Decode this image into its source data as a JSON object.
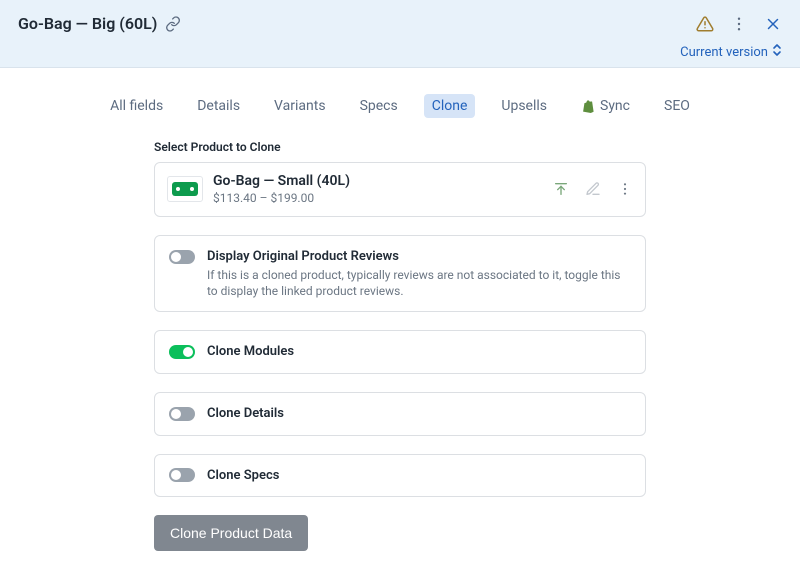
{
  "header": {
    "title": "Go-Bag — Big (60L)",
    "version_label": "Current version"
  },
  "tabs": {
    "all_fields": "All fields",
    "details": "Details",
    "variants": "Variants",
    "specs": "Specs",
    "clone": "Clone",
    "upsells": "Upsells",
    "sync": "Sync",
    "seo": "SEO"
  },
  "clone": {
    "section_label": "Select Product to Clone",
    "product": {
      "name": "Go-Bag — Small (40L)",
      "price": "$113.40 – $199.00"
    },
    "toggles": {
      "reviews": {
        "title": "Display Original Product Reviews",
        "desc": "If this is a cloned product, typically reviews are not associated to it, toggle this to display the linked product reviews.",
        "on": false
      },
      "modules": {
        "title": "Clone Modules",
        "on": true
      },
      "details": {
        "title": "Clone Details",
        "on": false
      },
      "specs": {
        "title": "Clone Specs",
        "on": false
      }
    },
    "button_label": "Clone Product Data"
  }
}
